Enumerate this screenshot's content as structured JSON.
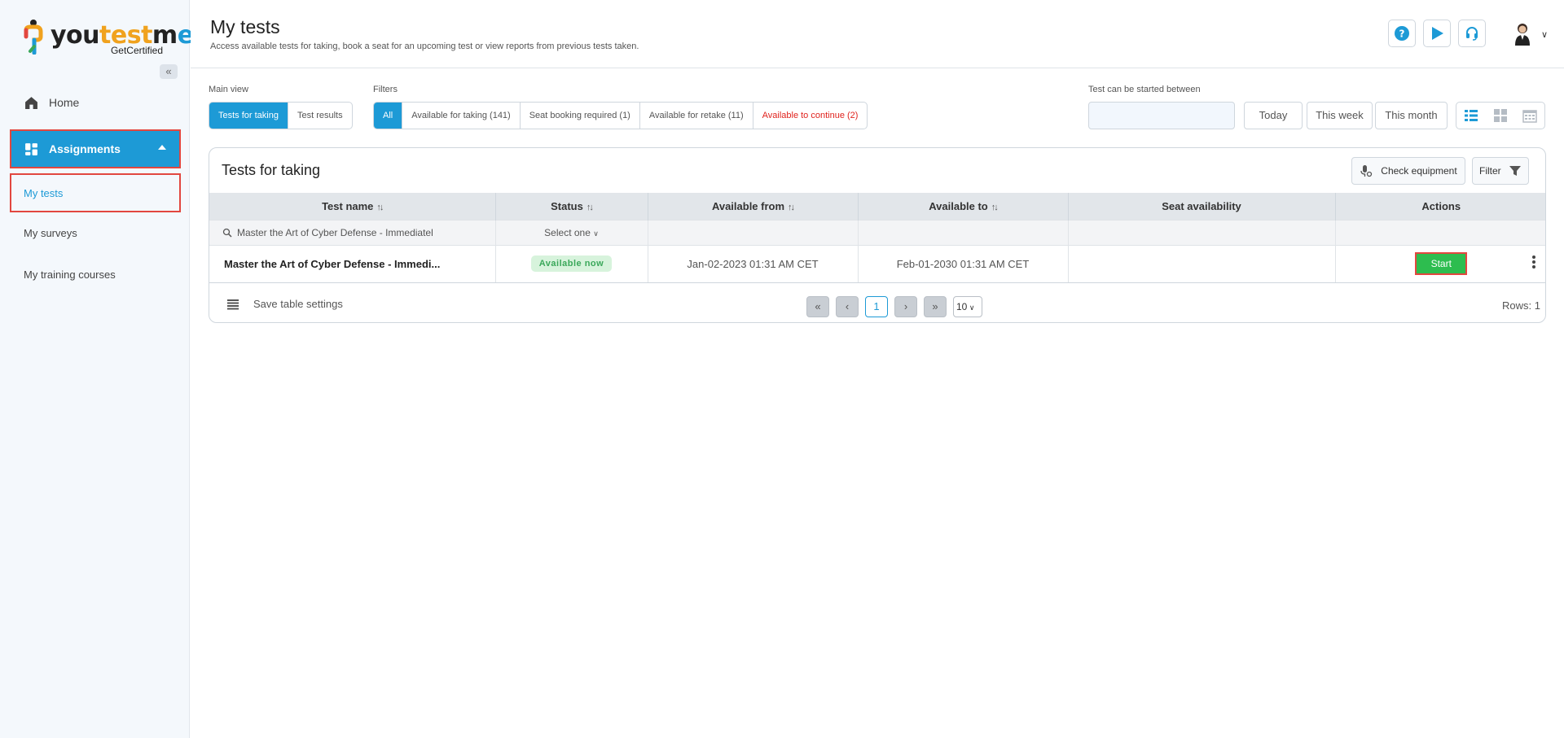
{
  "brand": {
    "logo_you": "you",
    "logo_test": "test",
    "logo_me_m": "m",
    "logo_me_e": "e",
    "sub": "GetCertified"
  },
  "sidebar": {
    "collapse": "«",
    "home": "Home",
    "assignments": "Assignments",
    "my_tests": "My tests",
    "my_surveys": "My surveys",
    "my_courses": "My training courses"
  },
  "header": {
    "title": "My tests",
    "subtitle": "Access available tests for taking, book a seat for an upcoming test or view reports from previous tests taken."
  },
  "main_view": {
    "label": "Main view",
    "tabs": [
      "Tests for taking",
      "Test results"
    ]
  },
  "filters": {
    "label": "Filters",
    "items": [
      "All",
      "Available for taking (141)",
      "Seat booking required (1)",
      "Available for retake (11)",
      "Available to continue (2)"
    ]
  },
  "date_range": {
    "label": "Test can be started between",
    "value": "",
    "today": "Today",
    "this_week": "This week",
    "this_month": "This month"
  },
  "card": {
    "title": "Tests for taking",
    "check_equipment": "Check equipment",
    "filter": "Filter"
  },
  "table": {
    "columns": [
      "Test name",
      "Status",
      "Available from",
      "Available to",
      "Seat availability",
      "Actions"
    ],
    "filter_row": {
      "search_value": "Master the Art of Cyber Defense - Immediatel",
      "status_select": "Select one"
    },
    "rows": [
      {
        "name": "Master the Art of Cyber Defense - Immedi...",
        "status": "Available now",
        "from": "Jan-02-2023 01:31 AM CET",
        "to": "Feb-01-2030 01:31 AM CET",
        "seat": "",
        "action": "Start"
      }
    ]
  },
  "footer": {
    "save_settings": "Save table settings",
    "page": "1",
    "page_size": "10",
    "rows": "Rows: 1"
  },
  "colors": {
    "accent": "#1d9ad6",
    "start": "#2dbd4f",
    "highlight": "#e2473f",
    "warning": "#e0231e"
  }
}
